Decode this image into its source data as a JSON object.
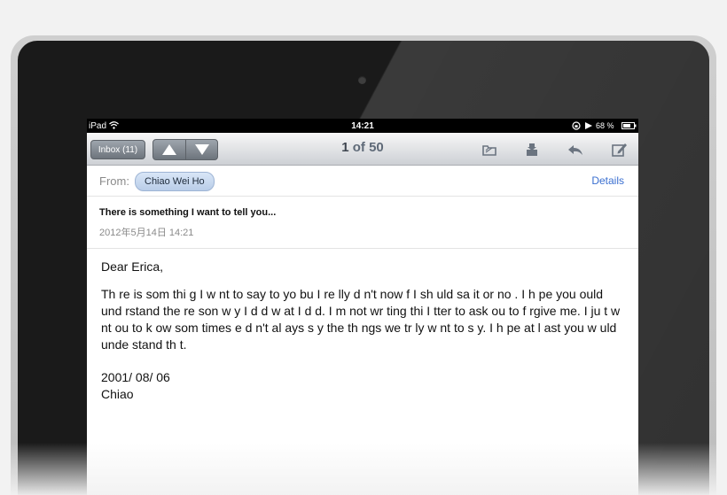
{
  "status_bar": {
    "carrier": "iPad",
    "time": "14:21",
    "battery": "68 %"
  },
  "toolbar": {
    "inbox_label": "Inbox (11)",
    "message_number": "1",
    "message_total": "of 50",
    "icons": [
      "up-arrow",
      "down-arrow",
      "folder",
      "archive",
      "reply",
      "compose"
    ]
  },
  "email": {
    "from_label": "From:",
    "sender": "Chiao Wei Ho",
    "details_label": "Details",
    "subject": "There is something I want to tell you...",
    "date": "2012年5月14日 14:21",
    "greeting": "Dear Erica,",
    "body": "Th re is som thi g I w nt to say to yo  bu  I re lly d n't  now  f I sh uld sa  it or no . I h pe you  ould und rstand the re son w y I d d w at I d d. I  m not wr ting thi  I tter to ask  ou to f rgive me. I ju t w nt  ou to k ow som times  e d n't al ays s y the th ngs we tr ly w nt to s y. I h pe at l ast you w uld unde stand th t.",
    "signature_date": "2001/ 08/ 06",
    "signature_name": "Chiao"
  }
}
